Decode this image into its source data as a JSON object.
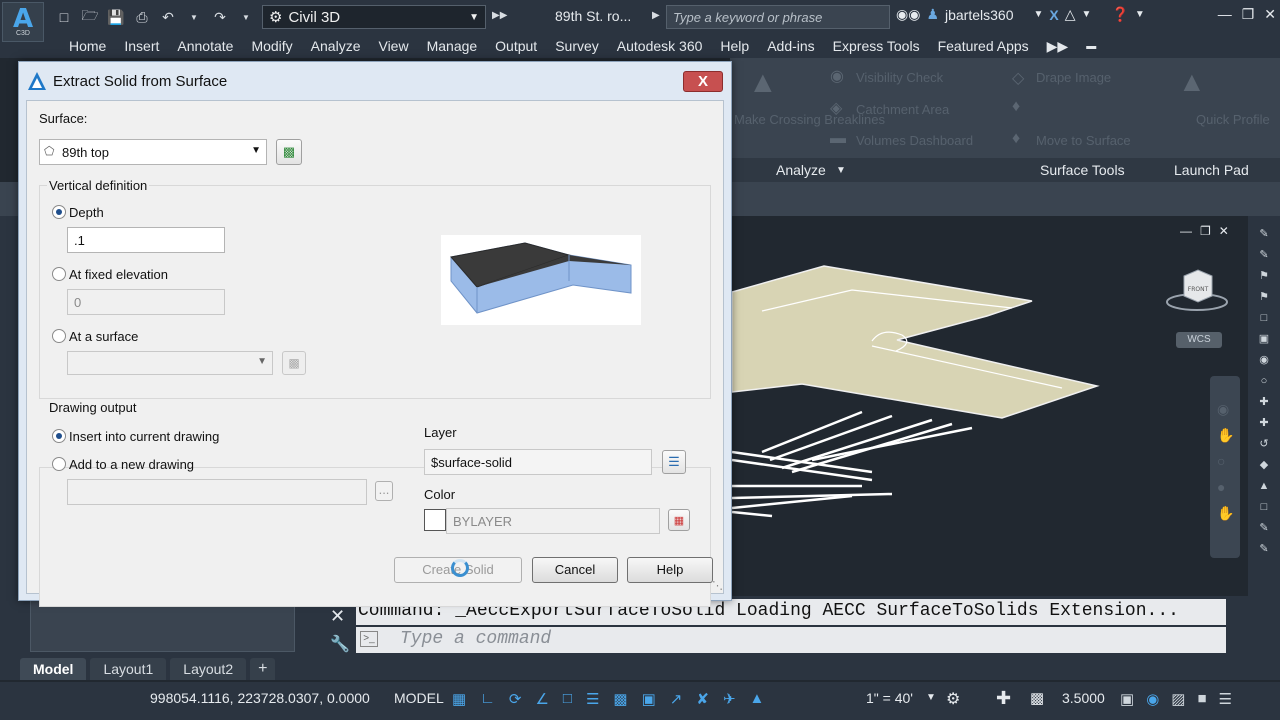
{
  "app": {
    "logo_letter": "A",
    "logo_sub": "C3D",
    "workspace": "Civil 3D",
    "doc_title": "89th St. ro...",
    "search_placeholder": "Type a keyword or phrase",
    "username": "jbartels360"
  },
  "menu": [
    "Home",
    "Insert",
    "Annotate",
    "Modify",
    "Analyze",
    "View",
    "Manage",
    "Output",
    "Survey",
    "Autodesk 360",
    "Help",
    "Add-ins",
    "Express Tools",
    "Featured Apps"
  ],
  "ribbon": {
    "items": [
      "Visibility Check",
      "Catchment Area",
      "Volumes Dashboard",
      "Drape Image",
      "Move to Surface",
      "Quick Profile",
      "Make Crossing Breaklines"
    ],
    "panels": [
      "Analyze",
      "Surface Tools",
      "Launch Pad"
    ]
  },
  "viewport": {
    "cube_label": "FRONT",
    "wcs": "WCS",
    "surface_color": "#d8d4b4"
  },
  "dialog": {
    "title": "Extract Solid from Surface",
    "close_label": "X",
    "surface_label": "Surface:",
    "surface_value": "89th top",
    "vertical_group": "Vertical definition",
    "depth_label": "Depth",
    "depth_value": ".1",
    "fixed_elev_label": "At fixed elevation",
    "fixed_elev_value": "0",
    "at_surface_label": "At a surface",
    "drawing_output_group": "Drawing output",
    "insert_current_label": "Insert into current drawing",
    "add_new_label": "Add to a new drawing",
    "browse_label": "...",
    "layer_label": "Layer",
    "layer_value": "$surface-solid",
    "color_label": "Color",
    "color_value": "BYLAYER",
    "create_label": "Create Solid",
    "cancel_label": "Cancel",
    "help_label": "Help"
  },
  "command": {
    "history": "Command: _AeccExportSurfaceToSolid Loading AECC SurfaceToSolids Extension...",
    "placeholder": "Type a command"
  },
  "layout_tabs": [
    "Model",
    "Layout1",
    "Layout2",
    "+"
  ],
  "status": {
    "coords": "998054.1116, 223728.0307, 0.0000",
    "space": "MODEL",
    "scale": "1\" = 40'",
    "value": "3.5000"
  }
}
